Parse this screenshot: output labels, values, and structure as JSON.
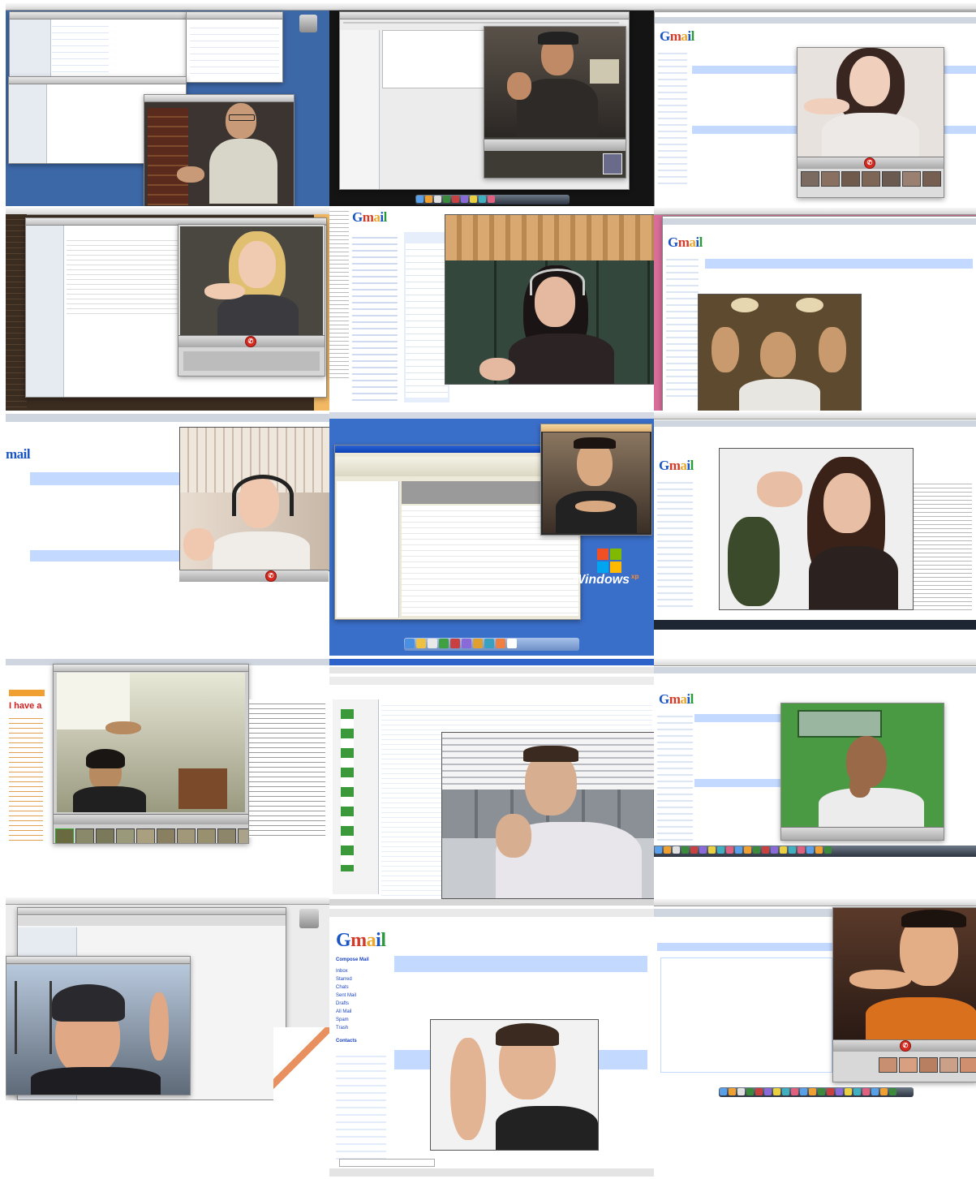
{
  "collage": {
    "tiles": [
      {
        "id": "t1",
        "caption": "",
        "app": "iChat"
      },
      {
        "id": "t2",
        "caption": "",
        "app": "iChat"
      },
      {
        "id": "t3",
        "caption": "",
        "app": "Gmail video chat"
      },
      {
        "id": "t4",
        "caption": "",
        "app": "Gmail video chat"
      },
      {
        "id": "t5",
        "caption": "",
        "app": "Gmail video chat"
      },
      {
        "id": "t6",
        "caption": "",
        "app": "Gmail video chat"
      },
      {
        "id": "t7",
        "caption": "",
        "app": "Gmail video chat"
      },
      {
        "id": "t8",
        "caption": "",
        "app": "Windows XP"
      },
      {
        "id": "t9",
        "caption": "",
        "app": "Gmail video chat"
      },
      {
        "id": "t10",
        "caption": "",
        "app": "Gmail video chat"
      },
      {
        "id": "t11",
        "caption": "",
        "app": "Browser"
      },
      {
        "id": "t12",
        "caption": "",
        "app": "Gmail video chat"
      },
      {
        "id": "t13",
        "caption": "",
        "app": "Video chat"
      },
      {
        "id": "t14",
        "caption": "",
        "app": "Gmail video chat"
      },
      {
        "id": "t15",
        "caption": "",
        "app": "Gmail video chat"
      }
    ]
  },
  "labels": {
    "gmail": "Gmail",
    "windows_logo": "Windows",
    "windows_sub": "xp",
    "gmail_side": "mail",
    "compose": "Compose Mail",
    "inbox": "Inbox",
    "starred": "Starred",
    "chats": "Chats",
    "sent": "Sent Mail",
    "drafts": "Drafts",
    "all_mail": "All Mail",
    "spam": "Spam",
    "trash": "Trash",
    "contacts": "Contacts",
    "end_call_glyph": "✆",
    "red_heading": "I have a"
  },
  "colors": {
    "gmail_blue": "#c3d9ff",
    "mac_desktop": "#3d68a8",
    "xp_desktop": "#3a6fc9",
    "end_call": "#d52a1f"
  }
}
